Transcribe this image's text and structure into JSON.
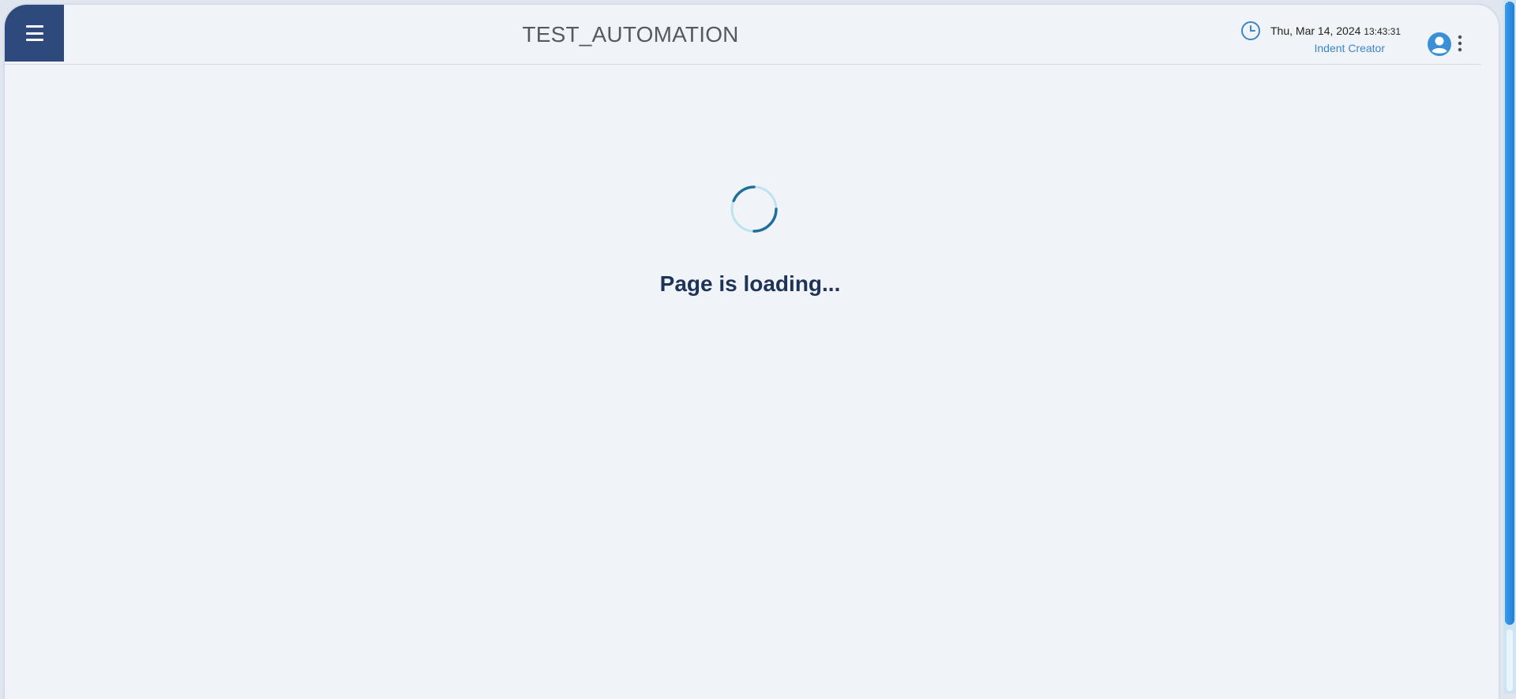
{
  "header": {
    "title": "TEST_AUTOMATION",
    "menu_icon": "hamburger-menu-icon",
    "clock_icon": "clock-icon",
    "date": "Thu, Mar 14, 2024",
    "time": "13:43:31",
    "role": "Indent Creator",
    "avatar_icon": "user-avatar-icon",
    "more_icon": "more-vertical-icon"
  },
  "main": {
    "loading_text": "Page is loading..."
  },
  "colors": {
    "menu_button_bg": "#2e4a7d",
    "accent_blue": "#3a86c8",
    "loading_text": "#1d3358",
    "spinner_arc": "#1f6f9c",
    "spinner_track": "#bfe3ee"
  }
}
